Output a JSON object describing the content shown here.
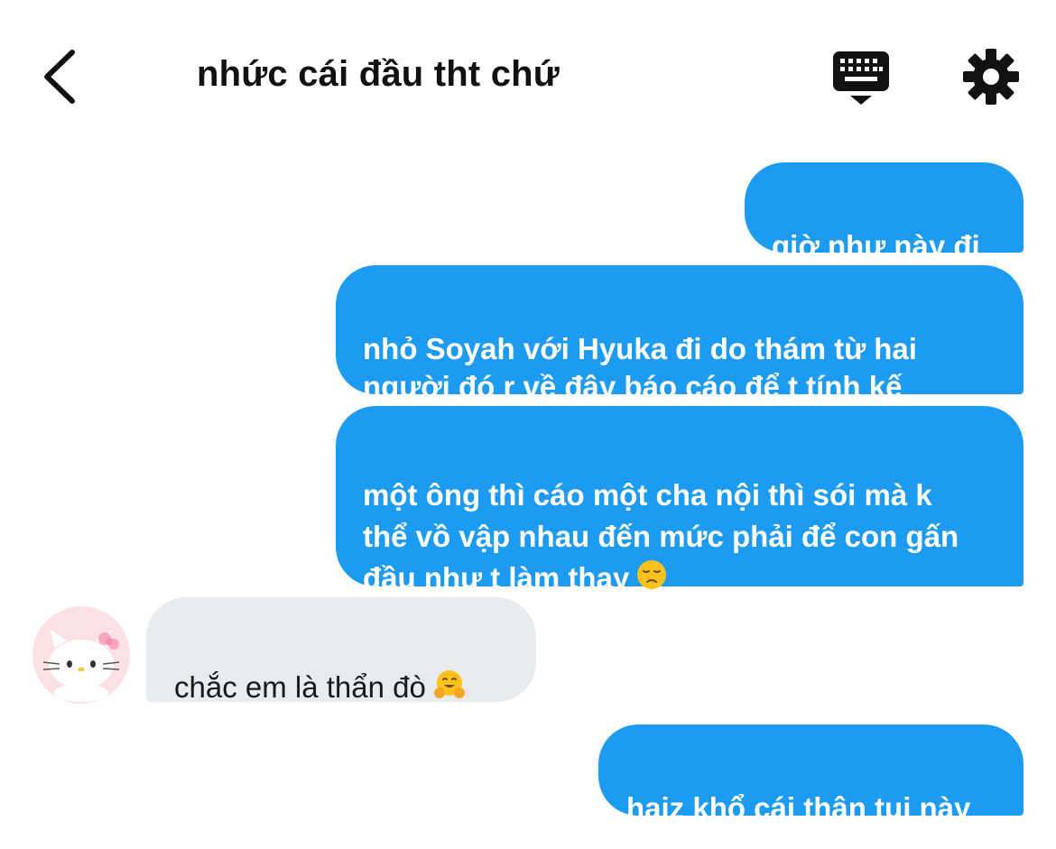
{
  "header": {
    "title": "nhức cái đầu tht chứ",
    "back_icon": "chevron-left-icon",
    "keyboard_icon": "keyboard-icon",
    "settings_icon": "gear-icon"
  },
  "messages": [
    {
      "from": "me",
      "text": "giờ như này đi"
    },
    {
      "from": "me",
      "text": "nhỏ Soyah với Hyuka đi do thám từ hai\nngười đó r về đây báo cáo để t tính kế"
    },
    {
      "from": "me",
      "text": "một ông thì cáo một cha nội thì sói mà k\nthể vồ vập nhau đến mức phải để con gấn\nđầu như t làm thay",
      "emoji": "disappointed-face"
    },
    {
      "from": "them",
      "text": "chắc em là thẩn đò",
      "emoji": "hugging-face",
      "avatar": "hello-kitty-avatar"
    },
    {
      "from": "me",
      "text": "haiz khổ cái thân tụi này"
    }
  ],
  "colors": {
    "outgoing_bubble": "#1d9bf0",
    "incoming_bubble": "#e9ecef",
    "outgoing_text": "#ffffff",
    "incoming_text": "#1a1a1a",
    "avatar_bg": "#fbe1e6"
  }
}
